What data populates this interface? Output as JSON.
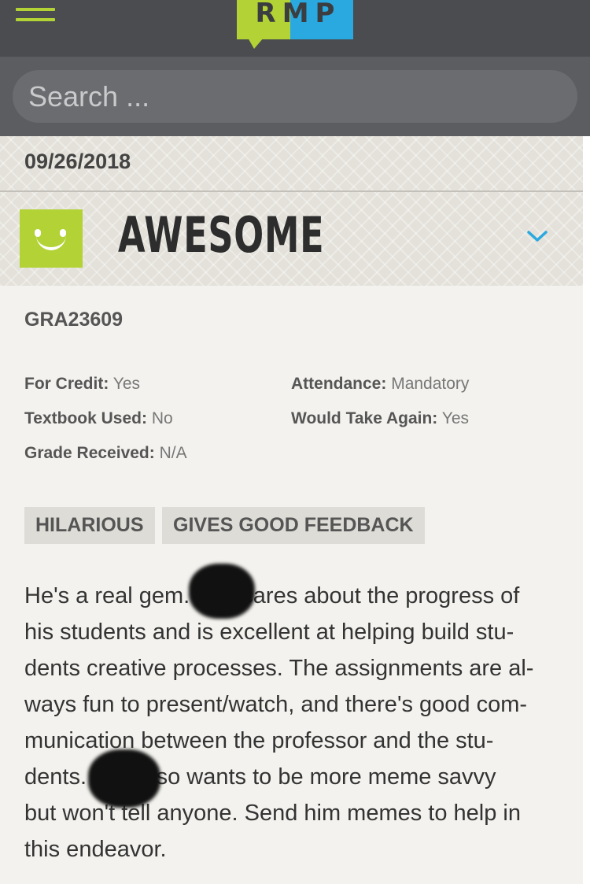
{
  "header": {
    "logo_text": "RMP",
    "brand_colors": {
      "green": "#b2d235",
      "blue": "#2aa8e0",
      "dark": "#4a4c4f"
    },
    "menu_icon": "hamburger-icon"
  },
  "search": {
    "placeholder": "Search ..."
  },
  "rating": {
    "date": "09/26/2018",
    "label": "AWESOME",
    "face_icon": "smiley-face-icon",
    "expand_icon": "chevron-down-icon"
  },
  "course": {
    "code": "GRA23609"
  },
  "meta": {
    "for_credit_label": "For Credit:",
    "for_credit_value": "Yes",
    "attendance_label": "Attendance:",
    "attendance_value": "Mandatory",
    "textbook_label": "Textbook Used:",
    "textbook_value": "No",
    "take_again_label": "Would Take Again:",
    "take_again_value": "Yes",
    "grade_label": "Grade Received:",
    "grade_value": "N/A"
  },
  "tags": [
    "HILARIOUS",
    "GIVES GOOD FEEDBACK"
  ],
  "comment": {
    "lines": [
      "He's a real gem. W  s cares about the progress of",
      "his students and is excellent at helping build stu-",
      "dents creative processes. The assignments are al-",
      "ways fun to present/watch, and there's good com-",
      "munication between the professor and the stu-",
      "dents. W  s also wants to be more meme savvy",
      "but won't tell anyone. Send him memes to help in",
      "this endeavor."
    ]
  }
}
